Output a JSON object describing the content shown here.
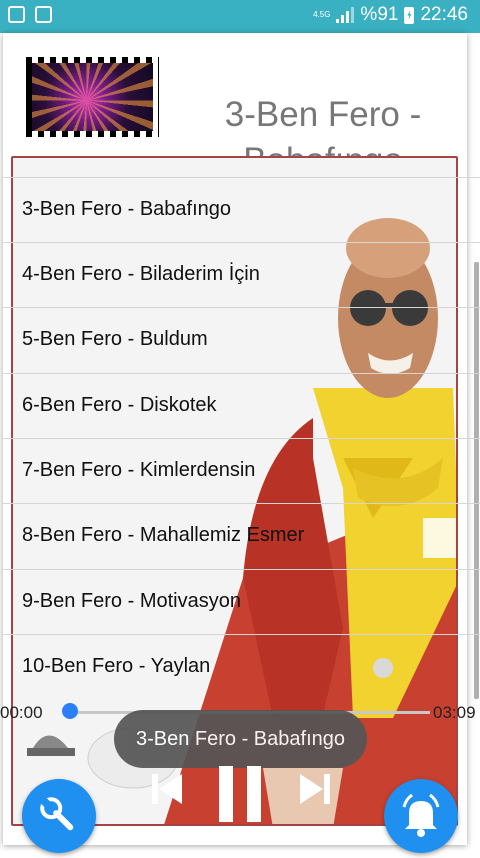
{
  "status_bar": {
    "network": "4.5G",
    "battery": "%91",
    "time": "22:46"
  },
  "now_playing": {
    "title": "3-Ben Fero - Babafıngo"
  },
  "playlist": [
    {
      "label": "3-Ben Fero - Babafıngo"
    },
    {
      "label": "4-Ben Fero - Biladerim İçin"
    },
    {
      "label": "5-Ben Fero - Buldum"
    },
    {
      "label": "6-Ben Fero - Diskotek"
    },
    {
      "label": "7-Ben Fero - Kimlerdensin"
    },
    {
      "label": "8-Ben Fero - Mahallemiz Esmer"
    },
    {
      "label": "9-Ben Fero - Motivasyon"
    },
    {
      "label": "10-Ben Fero - Yaylan"
    }
  ],
  "player": {
    "elapsed": "00:00",
    "duration": "03:09",
    "progress": 0.0,
    "toast": "3-Ben Fero - Babafıngo"
  },
  "colors": {
    "status_bar": "#39b1c2",
    "fab": "#1f8ff0",
    "seek_thumb": "#2d7ff9",
    "frame_border": "#a44444"
  },
  "icons": {
    "left_fab": "wrench-icon",
    "right_fab": "bell-icon",
    "prev": "skip-previous-icon",
    "pause": "pause-icon",
    "next": "skip-next-icon"
  }
}
